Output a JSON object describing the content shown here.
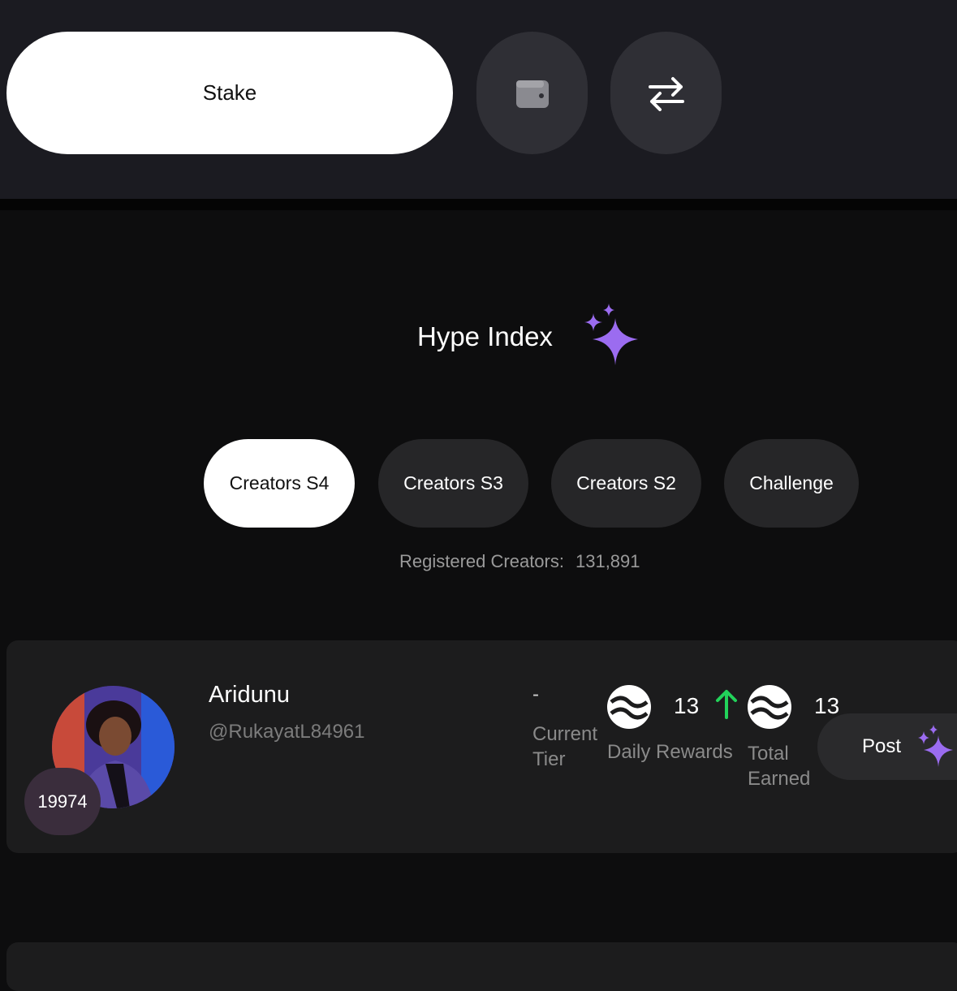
{
  "header": {
    "stake_label": "Stake",
    "wallet_icon": "wallet-icon",
    "swap_icon": "swap-arrows-icon"
  },
  "hype": {
    "title": "Hype Index",
    "icon": "sparkle-icon",
    "accent_color": "#9b6cf0"
  },
  "tabs": [
    {
      "label": "Creators S4",
      "active": true
    },
    {
      "label": "Creators S3",
      "active": false
    },
    {
      "label": "Creators S2",
      "active": false
    },
    {
      "label": "Challenge",
      "active": false
    }
  ],
  "registered": {
    "label": "Registered Creators:",
    "count": "131,891"
  },
  "creator": {
    "rank": "19974",
    "name": "Aridunu",
    "handle": "@RukayatL84961",
    "tier_value": "-",
    "tier_label": "Current Tier",
    "daily_value": "13",
    "daily_label": "Daily Rewards",
    "total_value": "13",
    "total_label": "Total Earned",
    "trend_color": "#22d35a",
    "post_label": "Post"
  }
}
